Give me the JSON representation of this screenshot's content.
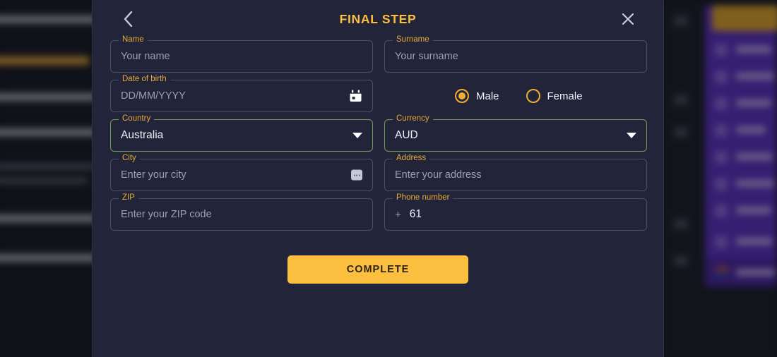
{
  "modal": {
    "title": "FINAL STEP",
    "back_icon": "chevron-left-icon",
    "close_icon": "close-icon"
  },
  "form": {
    "name": {
      "label": "Name",
      "placeholder": "Your name",
      "value": ""
    },
    "surname": {
      "label": "Surname",
      "placeholder": "Your surname",
      "value": ""
    },
    "date_of_birth": {
      "label": "Date of birth",
      "placeholder": "DD/MM/YYYY",
      "value": "",
      "icon": "calendar-icon"
    },
    "gender": {
      "options": [
        {
          "label": "Male",
          "selected": true
        },
        {
          "label": "Female",
          "selected": false
        }
      ]
    },
    "country": {
      "label": "Country",
      "value": "Australia",
      "state": "valid",
      "icon": "chevron-down-icon"
    },
    "currency": {
      "label": "Currency",
      "value": "AUD",
      "state": "valid",
      "icon": "chevron-down-icon"
    },
    "city": {
      "label": "City",
      "placeholder": "Enter your city",
      "value": "",
      "icon": "autofill-icon"
    },
    "address": {
      "label": "Address",
      "placeholder": "Enter your address",
      "value": ""
    },
    "zip": {
      "label": "ZIP",
      "placeholder": "Enter your ZIP code",
      "value": ""
    },
    "phone": {
      "label": "Phone number",
      "prefix": "+",
      "value": "61"
    }
  },
  "submit": {
    "label": "COMPLETE"
  },
  "colors": {
    "accent": "#fcbf3f",
    "label": "#e9a83c",
    "valid_border": "#6f9a52",
    "field_border": "#4a4f68",
    "modal_bg": "#22253a",
    "page_bg": "#171a24",
    "sidebar_purple": "#5b30c4"
  }
}
